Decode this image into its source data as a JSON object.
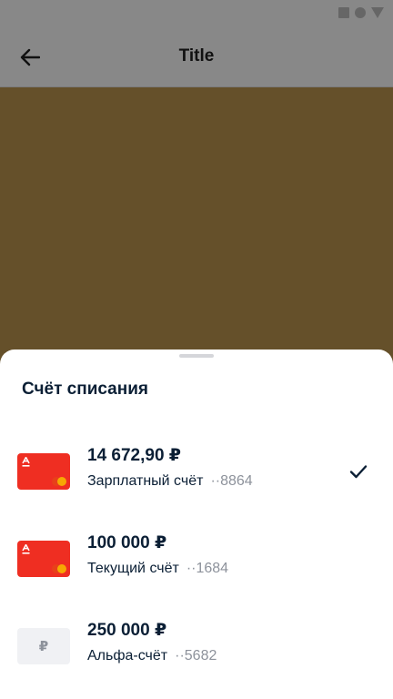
{
  "status_bar": {
    "icons": [
      "square-icon",
      "circle-icon",
      "triangle-icon"
    ]
  },
  "app_bar": {
    "title": "Title",
    "back_icon": "arrow-left-icon"
  },
  "sheet": {
    "title": "Счёт списания",
    "accounts": [
      {
        "amount": "14 672,90 ₽",
        "name": "Зарплатный счёт",
        "number": "··8864",
        "card": "red-card",
        "selected": true
      },
      {
        "amount": "100 000 ₽",
        "name": "Текущий счёт",
        "number": "··1684",
        "card": "red-card",
        "selected": false
      },
      {
        "amount": "250 000 ₽",
        "name": "Альфа-счёт",
        "number": "··5682",
        "card": "grey-ruble-card",
        "selected": false,
        "card_symbol": "₽"
      }
    ]
  },
  "colors": {
    "brand_red": "#ef2e22",
    "sheet_bg": "#ffffff",
    "scrim": "#65502a",
    "text_primary": "#0b1f35",
    "text_secondary": "#8d929b"
  }
}
